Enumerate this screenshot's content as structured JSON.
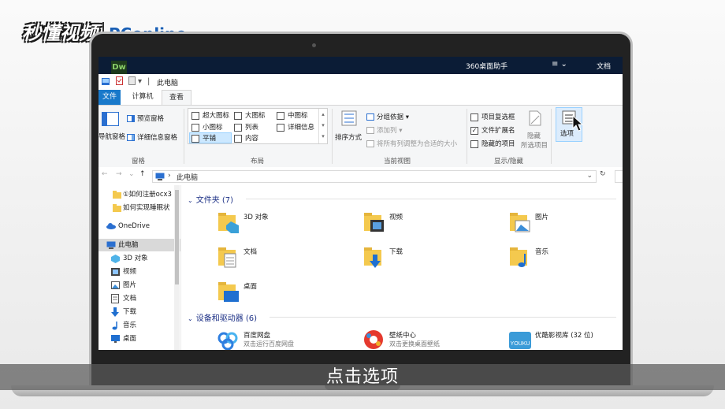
{
  "watermark": {
    "brand": "秒懂视频",
    "partner": "PConline"
  },
  "topstrip": {
    "app360": "360桌面助手",
    "menu": "≡ ⌄",
    "doc": "文档",
    "dw_label": "Dw"
  },
  "window": {
    "title": "此电脑",
    "qa_sep": "|",
    "qa_arrow": "▾"
  },
  "tabs": {
    "file": "文件",
    "computer": "计算机",
    "view": "查看"
  },
  "ribbon": {
    "nav_pane": "导航窗格",
    "preview_pane": "预览窗格",
    "details_pane": "详细信息窗格",
    "panes_group": "窗格",
    "layout": [
      "超大图标",
      "大图标",
      "中图标",
      "小图标",
      "列表",
      "详细信息",
      "平铺",
      "内容"
    ],
    "layout_group": "布局",
    "sort_by": "排序方式",
    "group_by": "分组依据",
    "add_columns": "添加列",
    "fit_columns": "将所有列调整为合适的大小",
    "current_view_group": "当前视图",
    "item_checkboxes": "项目复选框",
    "file_extensions": "文件扩展名",
    "hidden_items": "隐藏的项目",
    "hide": "隐藏",
    "selected_items": "所选项目",
    "show_hide_group": "显示/隐藏",
    "options": "选项"
  },
  "address": {
    "path": "此电脑",
    "sep": "›",
    "back": "←",
    "forward": "→",
    "up": "↑",
    "recent": "⌄",
    "dropdown": "⌄",
    "refresh": "↻"
  },
  "nav": {
    "items": [
      {
        "label": "①如何注册ocx3",
        "icon": "folder-icon"
      },
      {
        "label": "如何实现睡眠状",
        "icon": "folder-icon"
      },
      {
        "label": "OneDrive",
        "icon": "cloud-icon"
      },
      {
        "label": "此电脑",
        "icon": "computer-icon"
      },
      {
        "label": "3D 对象",
        "icon": "cube-icon"
      },
      {
        "label": "视频",
        "icon": "video-icon"
      },
      {
        "label": "图片",
        "icon": "picture-icon"
      },
      {
        "label": "文档",
        "icon": "document-icon"
      },
      {
        "label": "下载",
        "icon": "download-icon"
      },
      {
        "label": "音乐",
        "icon": "music-icon"
      },
      {
        "label": "桌面",
        "icon": "desktop-icon"
      }
    ]
  },
  "content": {
    "folders_header": "文件夹 (7)",
    "folders": [
      "3D 对象",
      "视频",
      "图片",
      "文档",
      "下载",
      "音乐",
      "桌面"
    ],
    "devices_header": "设备和驱动器 (6)",
    "devices": [
      {
        "name": "百度网盘",
        "sub": "双击运行百度网盘"
      },
      {
        "name": "壁纸中心",
        "sub": "双击更换桌面壁纸"
      },
      {
        "name": "优酷影视库 (32 位)",
        "sub": ""
      }
    ],
    "youku_text": "YOUKU"
  },
  "caption": "点击选项",
  "colors": {
    "accent": "#1979ca",
    "header_blue": "#1e3287",
    "folder": "#f4c94e"
  }
}
